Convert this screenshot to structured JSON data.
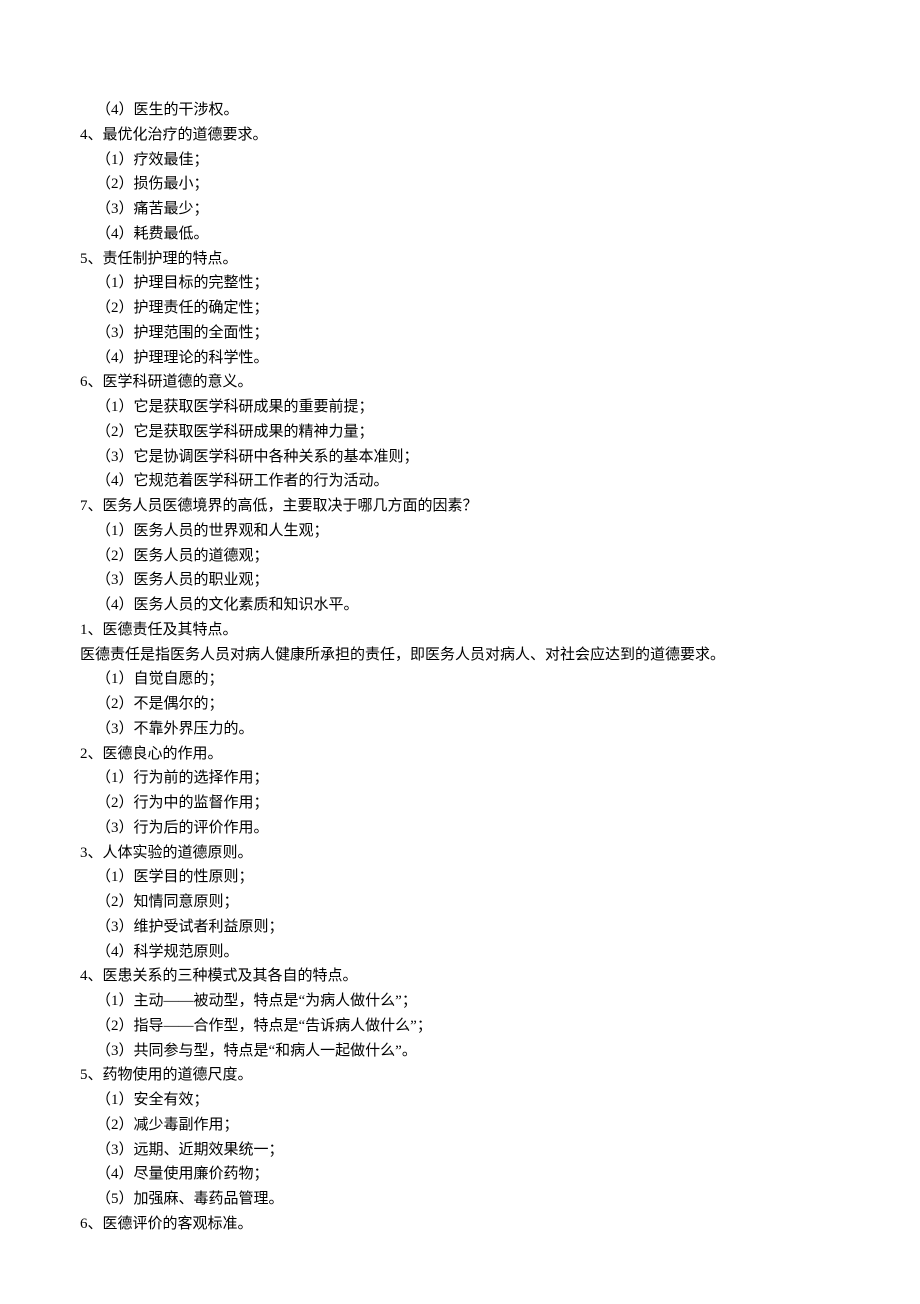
{
  "lines": [
    {
      "text": "（4）医生的干涉权。",
      "indent": 1
    },
    {
      "text": "4、最优化治疗的道德要求。",
      "indent": 0
    },
    {
      "text": "（1）疗效最佳；",
      "indent": 1
    },
    {
      "text": "（2）损伤最小；",
      "indent": 1
    },
    {
      "text": "（3）痛苦最少；",
      "indent": 1
    },
    {
      "text": "（4）耗费最低。",
      "indent": 1
    },
    {
      "text": "5、责任制护理的特点。",
      "indent": 0
    },
    {
      "text": "（1）护理目标的完整性；",
      "indent": 1
    },
    {
      "text": "（2）护理责任的确定性；",
      "indent": 1
    },
    {
      "text": "（3）护理范围的全面性；",
      "indent": 1
    },
    {
      "text": "（4）护理理论的科学性。",
      "indent": 1
    },
    {
      "text": "6、医学科研道德的意义。",
      "indent": 0
    },
    {
      "text": "（1）它是获取医学科研成果的重要前提；",
      "indent": 1
    },
    {
      "text": "（2）它是获取医学科研成果的精神力量；",
      "indent": 1
    },
    {
      "text": "（3）它是协调医学科研中各种关系的基本准则；",
      "indent": 1
    },
    {
      "text": "（4）它规范着医学科研工作者的行为活动。",
      "indent": 1
    },
    {
      "text": "7、医务人员医德境界的高低，主要取决于哪几方面的因素？",
      "indent": 0
    },
    {
      "text": "（1）医务人员的世界观和人生观；",
      "indent": 1
    },
    {
      "text": "（2）医务人员的道德观；",
      "indent": 1
    },
    {
      "text": "（3）医务人员的职业观；",
      "indent": 1
    },
    {
      "text": "（4）医务人员的文化素质和知识水平。",
      "indent": 1
    },
    {
      "text": "1、医德责任及其特点。",
      "indent": 0
    },
    {
      "text": "医德责任是指医务人员对病人健康所承担的责任，即医务人员对病人、对社会应达到的道德要求。",
      "indent": 0
    },
    {
      "text": "（1）自觉自愿的；",
      "indent": 1
    },
    {
      "text": "（2）不是偶尔的；",
      "indent": 1
    },
    {
      "text": "（3）不靠外界压力的。",
      "indent": 1
    },
    {
      "text": "2、医德良心的作用。",
      "indent": 0
    },
    {
      "text": "（1）行为前的选择作用；",
      "indent": 1
    },
    {
      "text": "（2）行为中的监督作用；",
      "indent": 1
    },
    {
      "text": "（3）行为后的评价作用。",
      "indent": 1
    },
    {
      "text": "3、人体实验的道德原则。",
      "indent": 0
    },
    {
      "text": "（1）医学目的性原则；",
      "indent": 1
    },
    {
      "text": "（2）知情同意原则；",
      "indent": 1
    },
    {
      "text": "（3）维护受试者利益原则；",
      "indent": 1
    },
    {
      "text": "（4）科学规范原则。",
      "indent": 1
    },
    {
      "text": "4、医患关系的三种模式及其各自的特点。",
      "indent": 0
    },
    {
      "text": "（1）主动——被动型，特点是“为病人做什么”；",
      "indent": 1
    },
    {
      "text": "（2）指导——合作型，特点是“告诉病人做什么”；",
      "indent": 1
    },
    {
      "text": "（3）共同参与型，特点是“和病人一起做什么”。",
      "indent": 1
    },
    {
      "text": "5、药物使用的道德尺度。",
      "indent": 0
    },
    {
      "text": "（1）安全有效；",
      "indent": 1
    },
    {
      "text": "（2）减少毒副作用；",
      "indent": 1
    },
    {
      "text": "（3）远期、近期效果统一；",
      "indent": 1
    },
    {
      "text": "（4）尽量使用廉价药物；",
      "indent": 1
    },
    {
      "text": "（5）加强麻、毒药品管理。",
      "indent": 1
    },
    {
      "text": "6、医德评价的客观标准。",
      "indent": 0
    }
  ]
}
